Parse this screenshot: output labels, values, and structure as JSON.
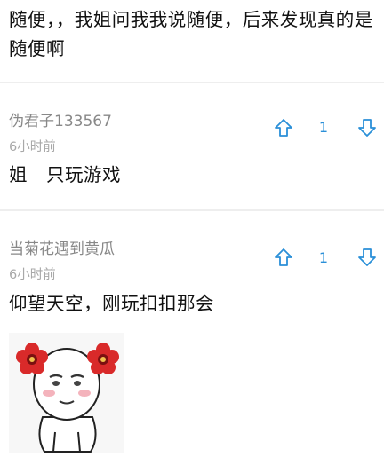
{
  "thread": {
    "tail_text": "随便，，我姐问我我说随便，后来发现真的是随便啊"
  },
  "comments": [
    {
      "username": "伪君子133567",
      "time": "6小时前",
      "text": "姐　只玩游戏",
      "votes": "1"
    },
    {
      "username": "当菊花遇到黄瓜",
      "time": "6小时前",
      "text": "仰望天空，刚玩扣扣那会",
      "votes": "1"
    }
  ],
  "colors": {
    "accent": "#2a8fd8",
    "flower": "#d92a2a",
    "username": "#888888",
    "time": "#a8a8a8"
  },
  "icons": {
    "upvote": "arrow-up-outline-icon",
    "downvote": "arrow-down-outline-icon"
  }
}
